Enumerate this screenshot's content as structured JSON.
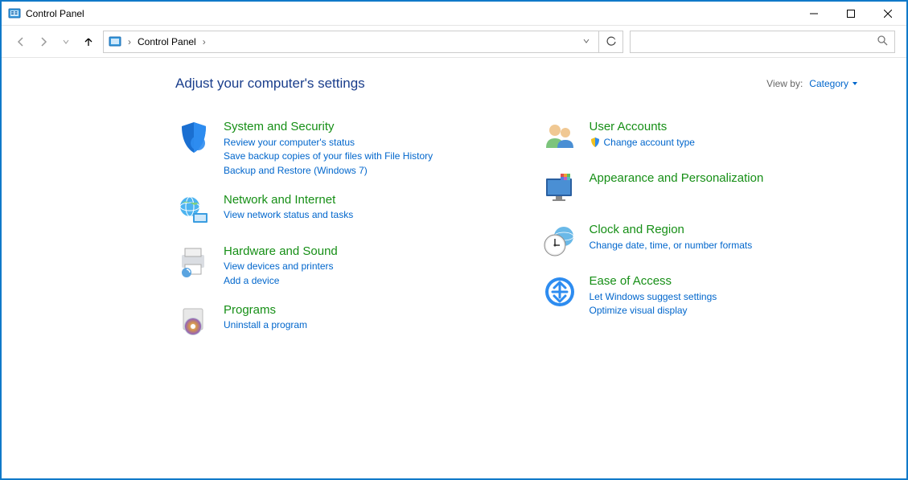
{
  "window": {
    "title": "Control Panel"
  },
  "address": {
    "location": "Control Panel"
  },
  "search": {
    "placeholder": ""
  },
  "head": {
    "title": "Adjust your computer's settings",
    "viewby_label": "View by:",
    "viewby_value": "Category"
  },
  "left": [
    {
      "title": "System and Security",
      "links": [
        "Review your computer's status",
        "Save backup copies of your files with File History",
        "Backup and Restore (Windows 7)"
      ]
    },
    {
      "title": "Network and Internet",
      "links": [
        "View network status and tasks"
      ]
    },
    {
      "title": "Hardware and Sound",
      "links": [
        "View devices and printers",
        "Add a device"
      ]
    },
    {
      "title": "Programs",
      "links": [
        "Uninstall a program"
      ]
    }
  ],
  "right": [
    {
      "title": "User Accounts",
      "links": [
        "Change account type"
      ],
      "shield": [
        true
      ]
    },
    {
      "title": "Appearance and Personalization",
      "links": []
    },
    {
      "title": "Clock and Region",
      "links": [
        "Change date, time, or number formats"
      ]
    },
    {
      "title": "Ease of Access",
      "links": [
        "Let Windows suggest settings",
        "Optimize visual display"
      ]
    }
  ]
}
